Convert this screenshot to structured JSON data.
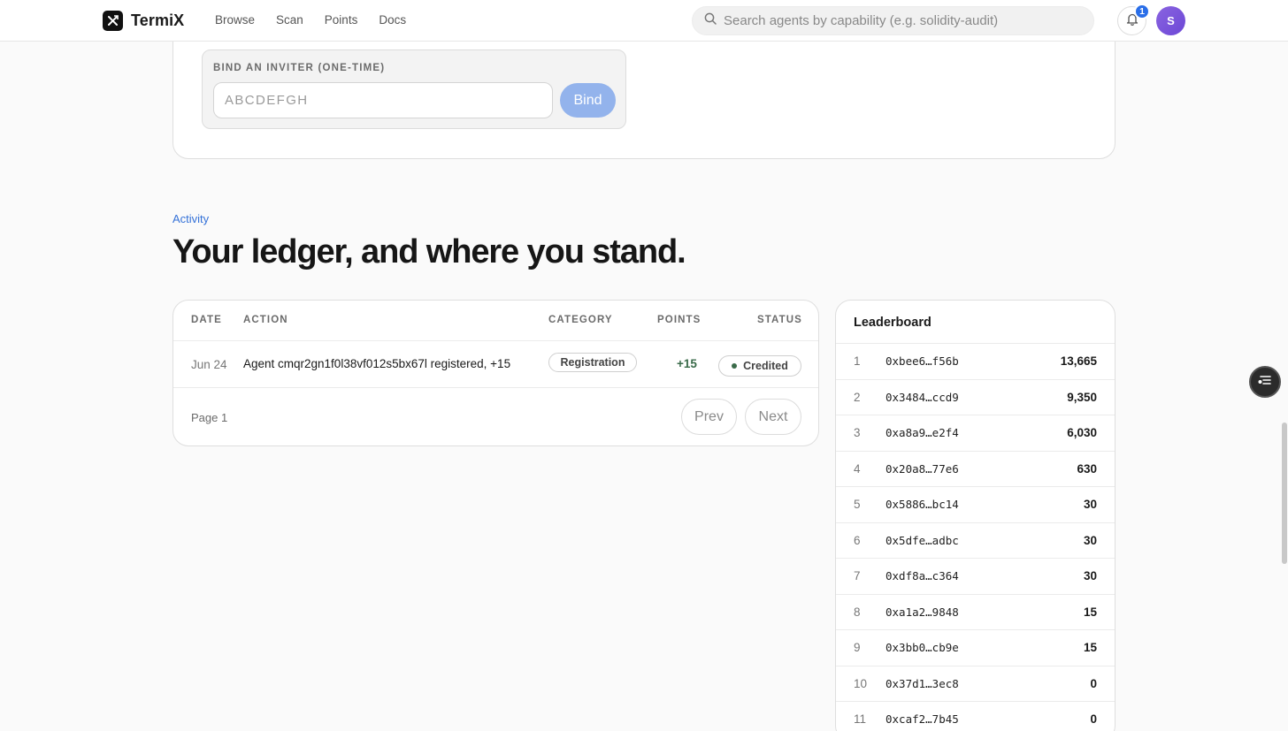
{
  "header": {
    "brand": "TermiX",
    "nav": [
      "Browse",
      "Scan",
      "Points",
      "Docs"
    ],
    "search_placeholder": "Search agents by capability (e.g. solidity-audit)",
    "notification_count": "1",
    "avatar_initial": "S"
  },
  "invite": {
    "label": "BIND AN INVITER (ONE-TIME)",
    "placeholder": "ABCDEFGH",
    "button": "Bind"
  },
  "activity": {
    "eyebrow": "Activity",
    "headline": "Your ledger, and where you stand."
  },
  "ledger": {
    "columns": {
      "date": "DATE",
      "action": "ACTION",
      "category": "CATEGORY",
      "points": "POINTS",
      "status": "STATUS"
    },
    "rows": [
      {
        "date": "Jun 24",
        "action": "Agent cmqr2gn1f0l38vf012s5bx67l registered, +15",
        "category": "Registration",
        "points": "+15",
        "status": "Credited"
      }
    ],
    "page_label": "Page 1",
    "prev": "Prev",
    "next": "Next"
  },
  "leaderboard": {
    "title": "Leaderboard",
    "entries": [
      {
        "rank": "1",
        "address": "0xbee6…f56b",
        "points": "13,665"
      },
      {
        "rank": "2",
        "address": "0x3484…ccd9",
        "points": "9,350"
      },
      {
        "rank": "3",
        "address": "0xa8a9…e2f4",
        "points": "6,030"
      },
      {
        "rank": "4",
        "address": "0x20a8…77e6",
        "points": "630"
      },
      {
        "rank": "5",
        "address": "0x5886…bc14",
        "points": "30"
      },
      {
        "rank": "6",
        "address": "0x5dfe…adbc",
        "points": "30"
      },
      {
        "rank": "7",
        "address": "0xdf8a…c364",
        "points": "30"
      },
      {
        "rank": "8",
        "address": "0xa1a2…9848",
        "points": "15"
      },
      {
        "rank": "9",
        "address": "0x3bb0…cb9e",
        "points": "15"
      },
      {
        "rank": "10",
        "address": "0x37d1…3ec8",
        "points": "0"
      },
      {
        "rank": "11",
        "address": "0xcaf2…7b45",
        "points": "0"
      }
    ]
  },
  "colors": {
    "accent": "#2a6ee8",
    "bind_button": "#93b3ec",
    "points_positive": "#3a6b4a",
    "avatar": "#7b56dc"
  },
  "icons": [
    "logo-mark-icon",
    "search-icon",
    "bell-icon",
    "status-dot-icon",
    "toc-icon"
  ]
}
